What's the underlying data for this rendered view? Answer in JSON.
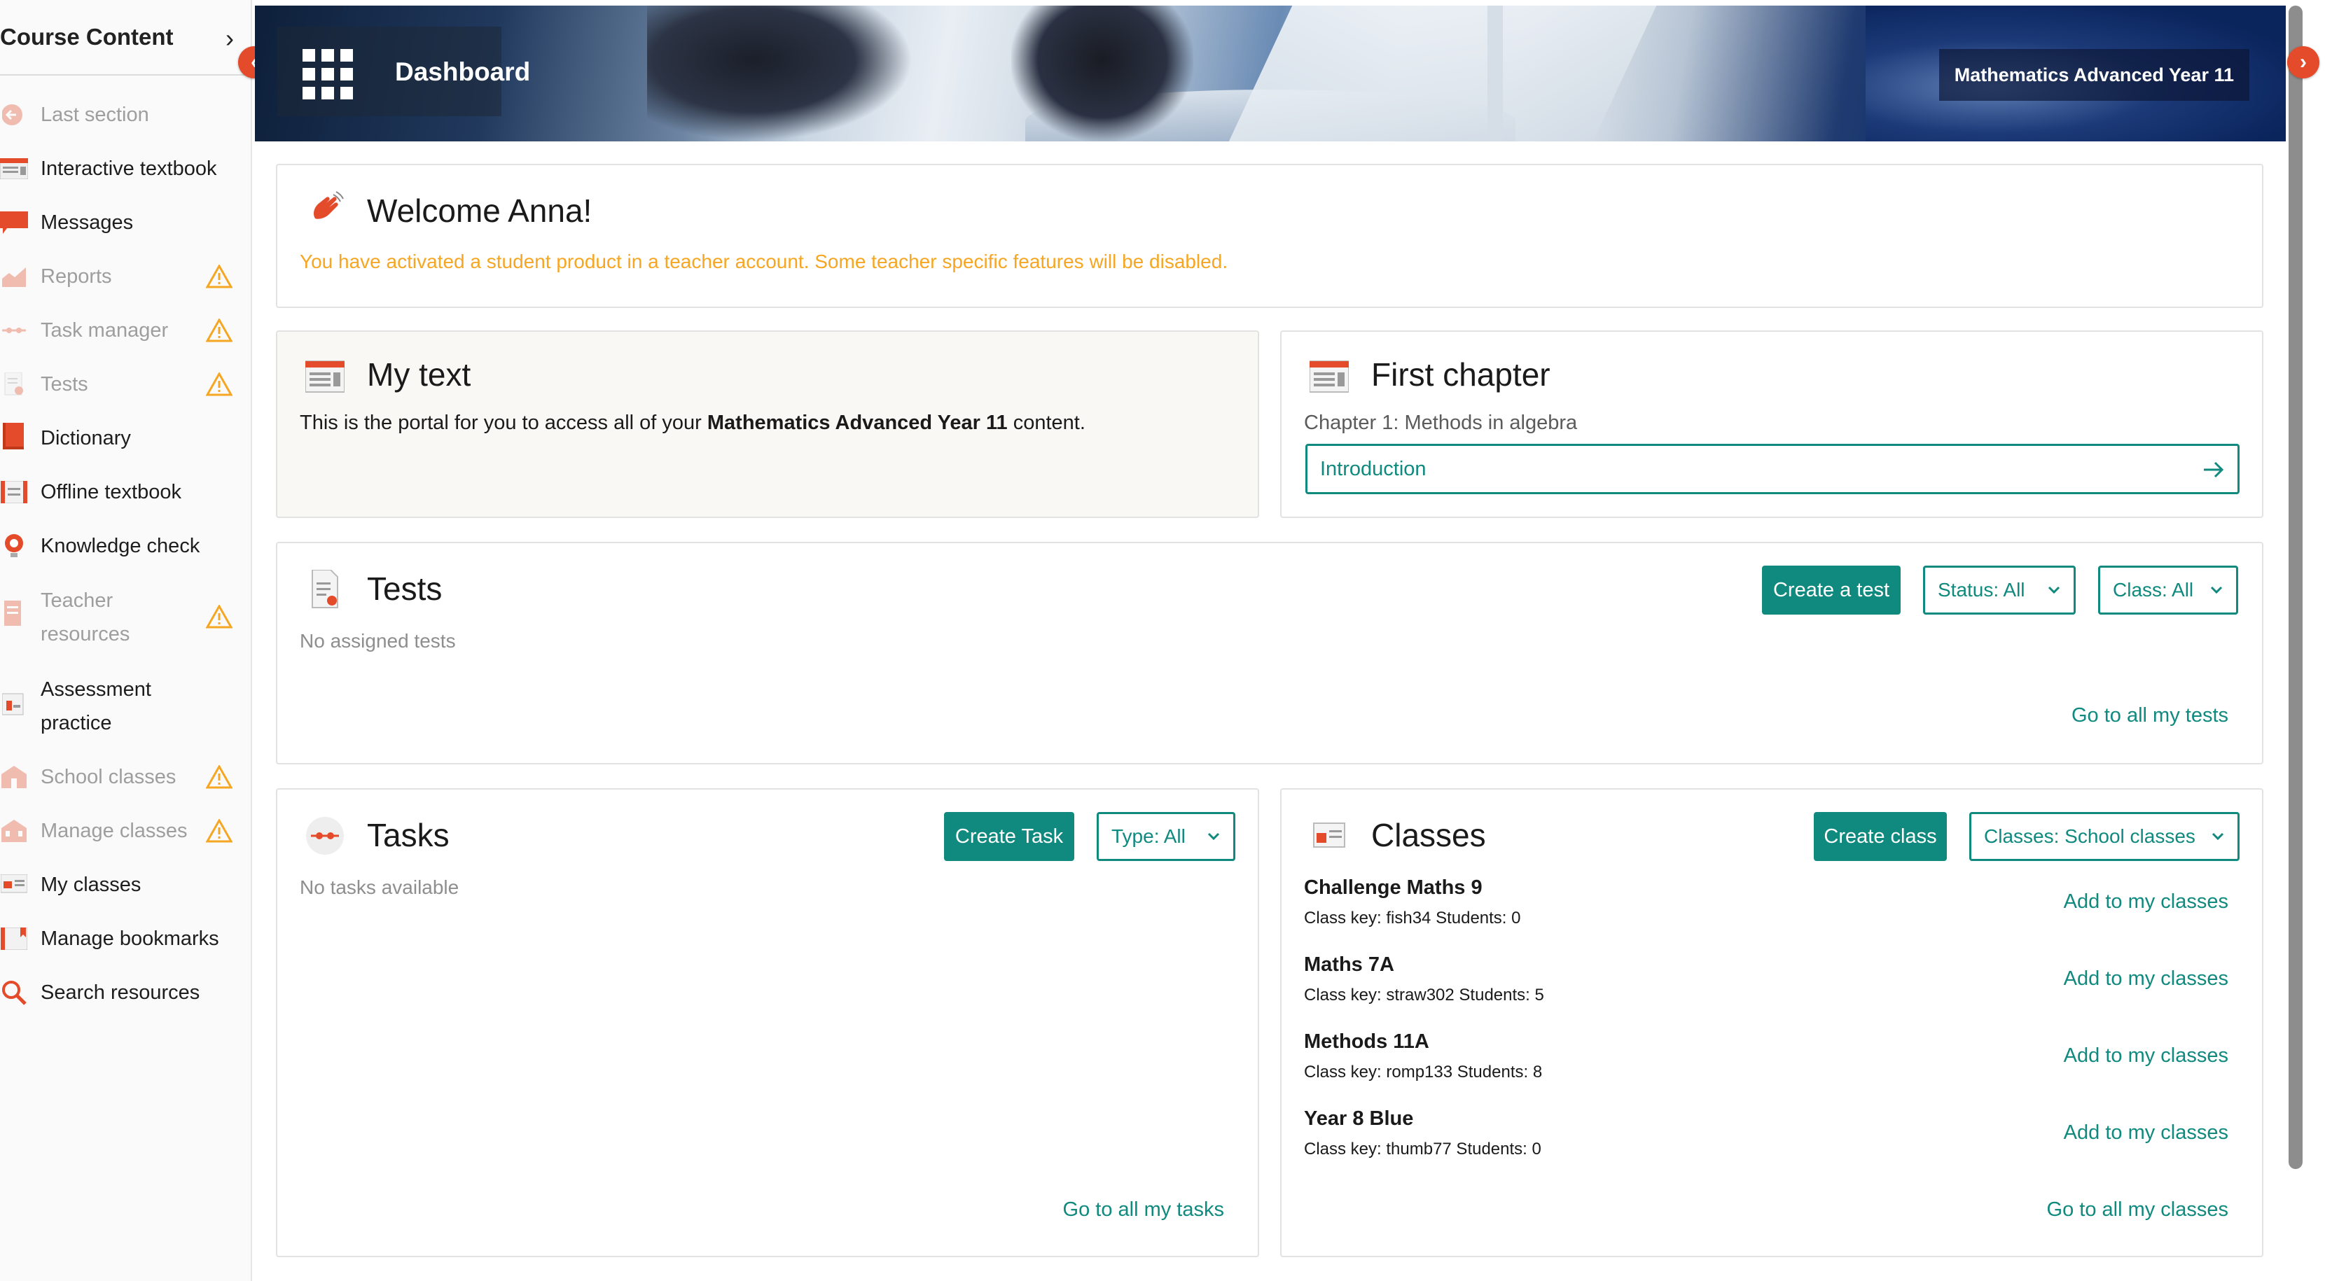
{
  "sidebar": {
    "title": "Course Content",
    "items": [
      {
        "label": "Last section",
        "icon": "back-arrow-icon",
        "disabled": true,
        "warning": false
      },
      {
        "label": "Interactive textbook",
        "icon": "textbook-icon",
        "disabled": false,
        "warning": false
      },
      {
        "label": "Messages",
        "icon": "message-icon",
        "disabled": false,
        "warning": false
      },
      {
        "label": "Reports",
        "icon": "chart-icon",
        "disabled": true,
        "warning": true
      },
      {
        "label": "Task manager",
        "icon": "task-icon",
        "disabled": true,
        "warning": true
      },
      {
        "label": "Tests",
        "icon": "test-icon",
        "disabled": true,
        "warning": true
      },
      {
        "label": "Dictionary",
        "icon": "book-icon",
        "disabled": false,
        "warning": false
      },
      {
        "label": "Offline textbook",
        "icon": "offline-book-icon",
        "disabled": false,
        "warning": false
      },
      {
        "label": "Knowledge check",
        "icon": "lightbulb-icon",
        "disabled": false,
        "warning": false
      },
      {
        "label": "Teacher",
        "label2": "resources",
        "icon": "teacher-resources-icon",
        "disabled": true,
        "warning": true
      },
      {
        "label": "Assessment",
        "label2": "practice",
        "icon": "assessment-icon",
        "disabled": false,
        "warning": false
      },
      {
        "label": "School classes",
        "icon": "school-icon",
        "disabled": true,
        "warning": true
      },
      {
        "label": "Manage classes",
        "icon": "manage-classes-icon",
        "disabled": true,
        "warning": true
      },
      {
        "label": "My classes",
        "icon": "my-classes-icon",
        "disabled": false,
        "warning": false
      },
      {
        "label": "Manage bookmarks",
        "icon": "bookmark-icon",
        "disabled": false,
        "warning": false
      },
      {
        "label": "Search resources",
        "icon": "search-icon",
        "disabled": false,
        "warning": false
      }
    ]
  },
  "banner": {
    "dashboard_label": "Dashboard",
    "course_name": "Mathematics Advanced Year 11"
  },
  "welcome": {
    "title": "Welcome Anna!",
    "notice": "You have activated a student product in a teacher account. Some teacher specific features will be disabled."
  },
  "my_text": {
    "title": "My text",
    "body_prefix": "This is the portal for you to access all of your ",
    "body_bold": "Mathematics Advanced Year 11",
    "body_suffix": " content."
  },
  "first_chapter": {
    "title": "First chapter",
    "subtitle": "Chapter 1: Methods in algebra",
    "link_label": "Introduction"
  },
  "tests": {
    "title": "Tests",
    "empty": "No assigned tests",
    "create_label": "Create a test",
    "status_filter": "Status: All",
    "class_filter": "Class: All",
    "all_link": "Go to all my tests"
  },
  "tasks": {
    "title": "Tasks",
    "empty": "No tasks available",
    "create_label": "Create Task",
    "type_filter": "Type: All",
    "all_link": "Go to all my tasks"
  },
  "classes": {
    "title": "Classes",
    "create_label": "Create class",
    "filter": "Classes: School classes",
    "add_label": "Add to my classes",
    "all_link": "Go to all my classes",
    "list": [
      {
        "name": "Challenge Maths 9",
        "meta": "Class key: fish34   Students: 0"
      },
      {
        "name": "Maths 7A",
        "meta": "Class key: straw302   Students: 5"
      },
      {
        "name": "Methods 11A",
        "meta": "Class key: romp133   Students: 8"
      },
      {
        "name": "Year 8 Blue",
        "meta": "Class key: thumb77   Students: 0"
      }
    ]
  },
  "colors": {
    "accent": "#108a7f",
    "brand": "#e34b2a",
    "warning": "#f5a623",
    "notice": "#f5a623"
  }
}
